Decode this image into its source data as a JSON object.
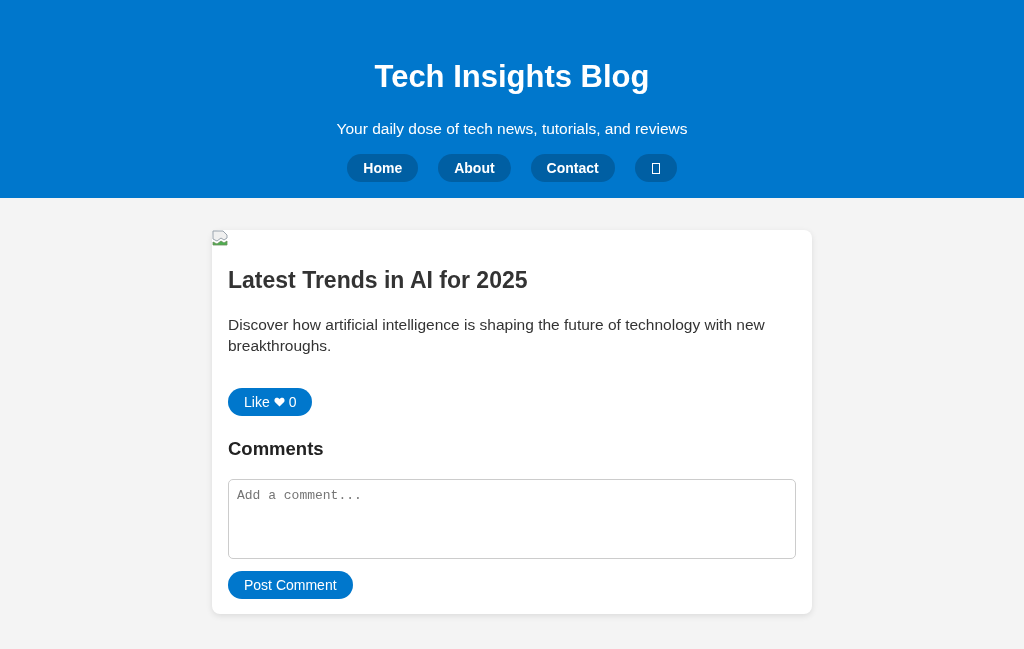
{
  "header": {
    "title": "Tech Insights Blog",
    "tagline": "Your daily dose of tech news, tutorials, and reviews",
    "nav": [
      {
        "kind": "link",
        "label": "Home"
      },
      {
        "kind": "link",
        "label": "About"
      },
      {
        "kind": "link",
        "label": "Contact"
      },
      {
        "kind": "icon"
      }
    ]
  },
  "post": {
    "title": "Latest Trends in AI for 2025",
    "summary": "Discover how artificial intelligence is shaping the future of technology with new breakthroughs.",
    "like": {
      "label": "Like",
      "count": "0"
    },
    "comments": {
      "heading": "Comments",
      "placeholder": "Add a comment...",
      "button": "Post Comment"
    }
  }
}
